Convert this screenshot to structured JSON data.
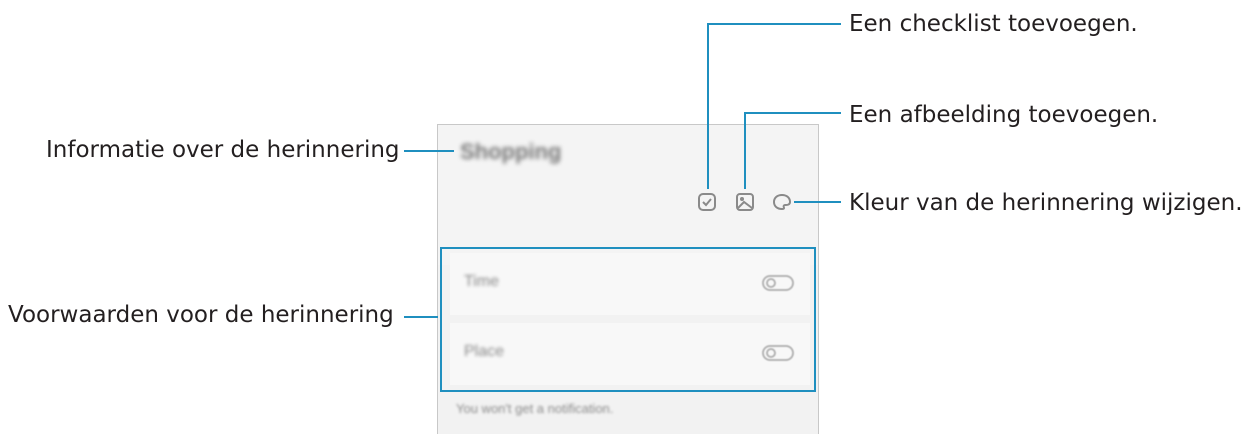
{
  "callouts": {
    "checklist": "Een checklist toevoegen.",
    "image": "Een afbeelding toevoegen.",
    "color": "Kleur van de herinnering wijzigen.",
    "info": "Informatie over de herinnering",
    "conditions": "Voorwaarden voor de herinnering"
  },
  "reminder": {
    "title": "Shopping",
    "conditions": [
      {
        "label": "Time",
        "enabled": false
      },
      {
        "label": "Place",
        "enabled": false
      }
    ],
    "footer": "You won't get a notification."
  },
  "colors": {
    "callout_line": "#1f8fbf",
    "text": "#231f20"
  },
  "icons": [
    "checklist-icon",
    "image-icon",
    "palette-icon"
  ]
}
